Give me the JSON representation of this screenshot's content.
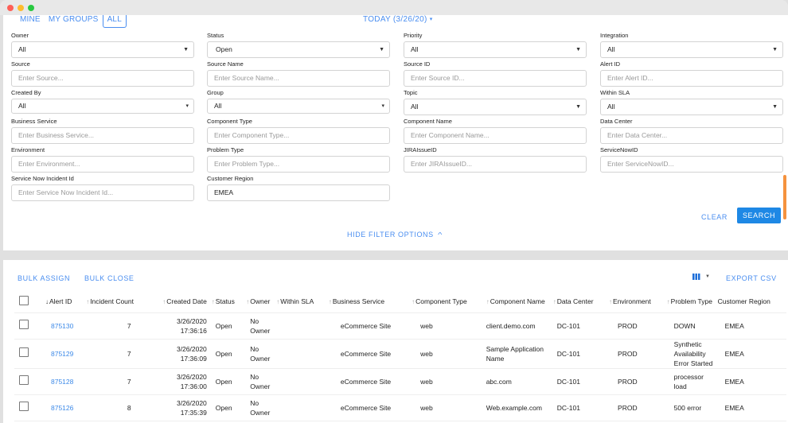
{
  "window": {
    "controls": [
      "close",
      "minimize",
      "maximize"
    ]
  },
  "scope_tabs": [
    {
      "label": "MINE",
      "active": false
    },
    {
      "label": "MY GROUPS",
      "active": false
    },
    {
      "label": "ALL",
      "active": true
    }
  ],
  "date_filter": {
    "label": "TODAY (3/26/20)",
    "caret": "▾"
  },
  "filters": {
    "owner": {
      "label": "Owner",
      "value": "All"
    },
    "status": {
      "label": "Status",
      "value": "Open"
    },
    "priority": {
      "label": "Priority",
      "value": "All"
    },
    "integration": {
      "label": "Integration",
      "value": "All"
    },
    "source": {
      "label": "Source",
      "placeholder": "Enter Source..."
    },
    "source_name": {
      "label": "Source Name",
      "placeholder": "Enter Source Name..."
    },
    "source_id": {
      "label": "Source ID",
      "placeholder": "Enter Source ID..."
    },
    "alert_id": {
      "label": "Alert ID",
      "placeholder": "Enter Alert ID..."
    },
    "created_by": {
      "label": "Created By",
      "value": "All"
    },
    "group": {
      "label": "Group",
      "value": "All"
    },
    "topic": {
      "label": "Topic",
      "value": "All"
    },
    "within_sla": {
      "label": "Within SLA",
      "value": "All"
    },
    "business_service": {
      "label": "Business Service",
      "placeholder": "Enter Business Service..."
    },
    "component_type": {
      "label": "Component Type",
      "placeholder": "Enter Component Type..."
    },
    "component_name": {
      "label": "Component Name",
      "placeholder": "Enter Component Name..."
    },
    "data_center": {
      "label": "Data Center",
      "placeholder": "Enter Data Center..."
    },
    "environment": {
      "label": "Environment",
      "placeholder": "Enter Environment..."
    },
    "problem_type": {
      "label": "Problem Type",
      "placeholder": "Enter Problem Type..."
    },
    "jira_issue_id": {
      "label": "JIRAIssueID",
      "placeholder": "Enter JIRAIssueID..."
    },
    "servicenow_id": {
      "label": "ServiceNowID",
      "placeholder": "Enter ServiceNowID..."
    },
    "servicenow_incident_id": {
      "label": "Service Now Incident Id",
      "placeholder": "Enter Service Now Incident Id..."
    },
    "customer_region": {
      "label": "Customer Region",
      "value": "EMEA"
    }
  },
  "actions": {
    "clear": "CLEAR",
    "search": "SEARCH",
    "hide_filters": "HIDE FILTER OPTIONS",
    "bulk_assign": "BULK ASSIGN",
    "bulk_close": "BULK CLOSE",
    "export_csv": "EXPORT CSV"
  },
  "colors": {
    "accent": "#4a8ef0",
    "primary_button": "#1e88e5",
    "scroll_indicator": "#f5923e"
  },
  "table": {
    "columns": [
      {
        "label": "Alert ID",
        "sort": "desc"
      },
      {
        "label": "Incident Count",
        "sort": "asc"
      },
      {
        "label": "Created Date",
        "sort": "asc"
      },
      {
        "label": "Status",
        "sort": "asc"
      },
      {
        "label": "Owner",
        "sort": "asc"
      },
      {
        "label": "Within SLA",
        "sort": "asc"
      },
      {
        "label": "Business Service",
        "sort": "asc"
      },
      {
        "label": "Component Type",
        "sort": "asc"
      },
      {
        "label": "Component Name",
        "sort": "asc"
      },
      {
        "label": "Data Center",
        "sort": "asc"
      },
      {
        "label": "Environment",
        "sort": "asc"
      },
      {
        "label": "Problem Type",
        "sort": "asc"
      },
      {
        "label": "Customer Region",
        "sort": "none"
      }
    ],
    "rows": [
      {
        "alert_id": "875130",
        "incident_count": "7",
        "date": "3/26/2020",
        "time": "17:36:16",
        "status": "Open",
        "owner": "No Owner",
        "within_sla": "",
        "business_service": "eCommerce Site",
        "component_type": "web",
        "component_name": "client.demo.com",
        "data_center": "DC-101",
        "environment": "PROD",
        "problem_type": "DOWN",
        "customer_region": "EMEA"
      },
      {
        "alert_id": "875129",
        "incident_count": "7",
        "date": "3/26/2020",
        "time": "17:36:09",
        "status": "Open",
        "owner": "No Owner",
        "within_sla": "",
        "business_service": "eCommerce Site",
        "component_type": "web",
        "component_name": "Sample Application Name",
        "data_center": "DC-101",
        "environment": "PROD",
        "problem_type": "Synthetic Availability Error Started",
        "customer_region": "EMEA"
      },
      {
        "alert_id": "875128",
        "incident_count": "7",
        "date": "3/26/2020",
        "time": "17:36:00",
        "status": "Open",
        "owner": "No Owner",
        "within_sla": "",
        "business_service": "eCommerce Site",
        "component_type": "web",
        "component_name": "abc.com",
        "data_center": "DC-101",
        "environment": "PROD",
        "problem_type": "processor load",
        "customer_region": "EMEA"
      },
      {
        "alert_id": "875126",
        "incident_count": "8",
        "date": "3/26/2020",
        "time": "17:35:39",
        "status": "Open",
        "owner": "No Owner",
        "within_sla": "",
        "business_service": "eCommerce Site",
        "component_type": "web",
        "component_name": "Web.example.com",
        "data_center": "DC-101",
        "environment": "PROD",
        "problem_type": "500 error",
        "customer_region": "EMEA"
      }
    ]
  }
}
